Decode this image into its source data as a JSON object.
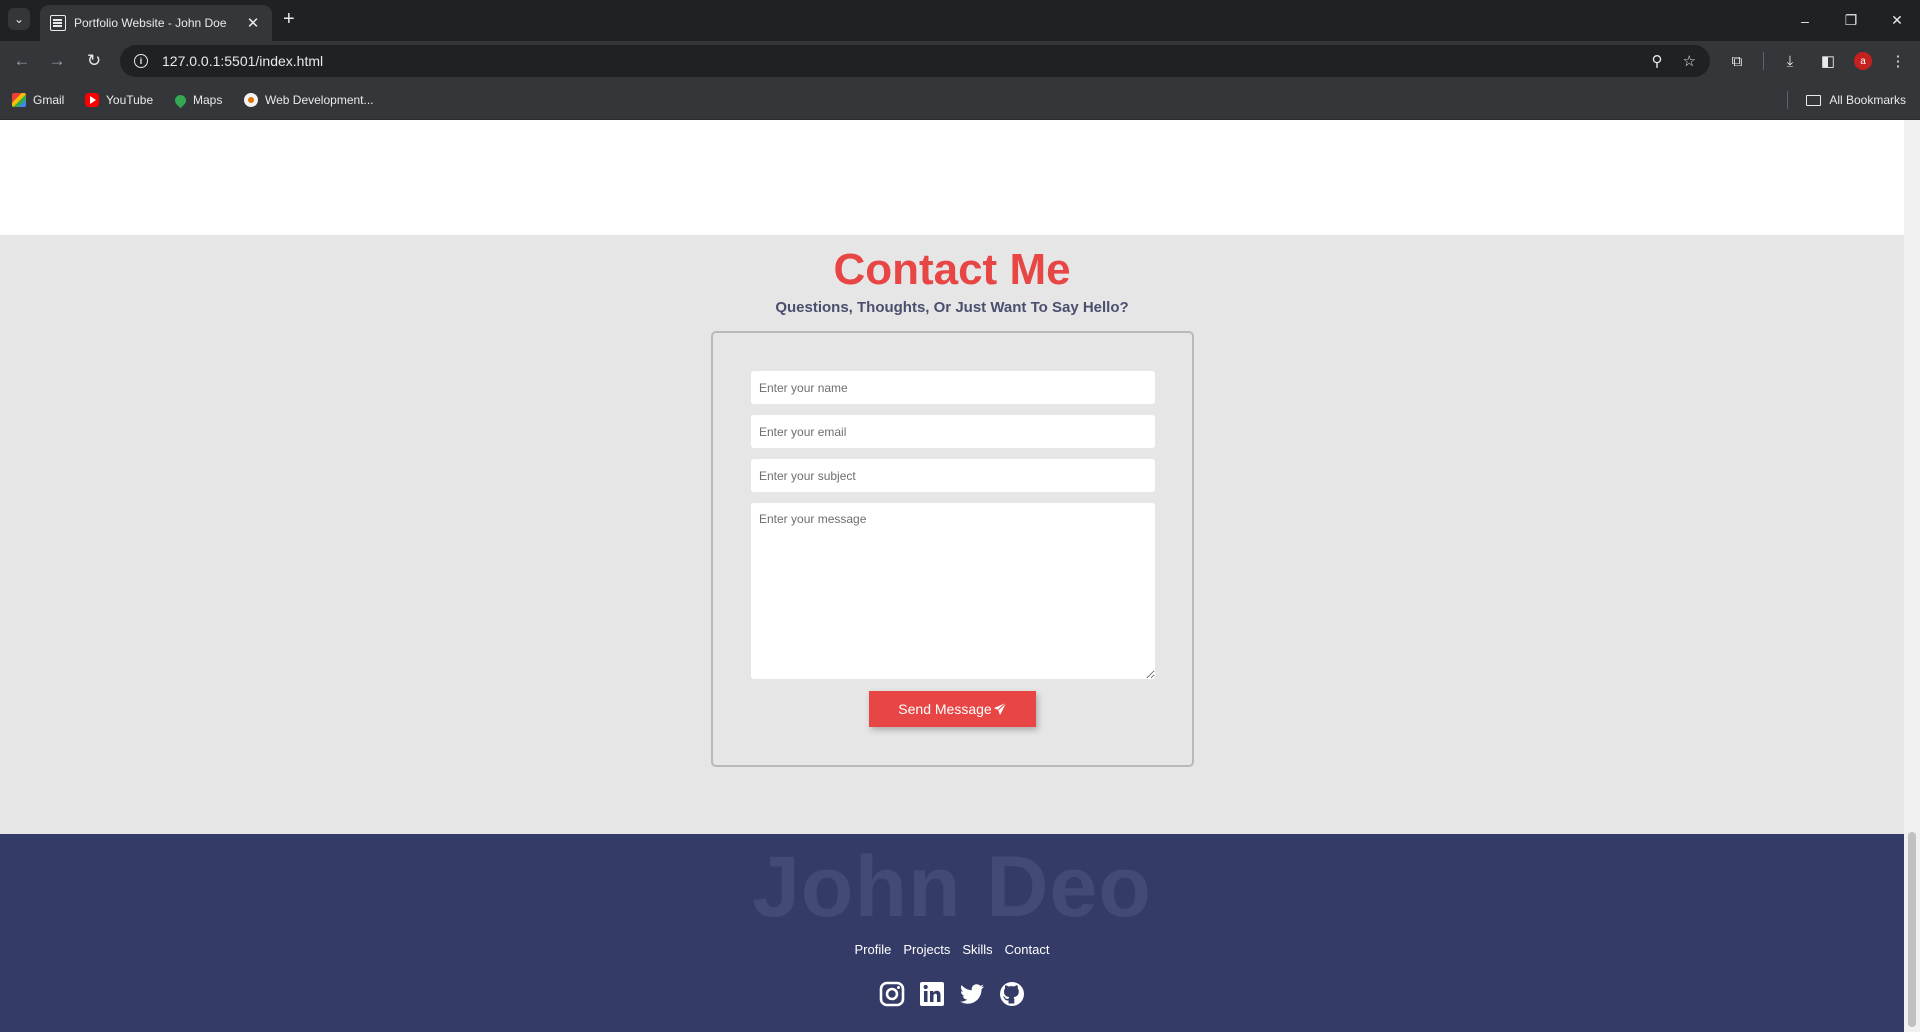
{
  "browser": {
    "tab_title": "Portfolio Website - John Doe",
    "url": "127.0.0.1:5501/index.html",
    "bookmarks": [
      "Gmail",
      "YouTube",
      "Maps",
      "Web Development..."
    ],
    "all_bookmarks": "All Bookmarks",
    "profile_initial": "a"
  },
  "contact": {
    "title": "Contact Me",
    "subtitle": "Questions, Thoughts, Or Just Want To Say Hello?",
    "name_placeholder": "Enter your name",
    "email_placeholder": "Enter your email",
    "subject_placeholder": "Enter your subject",
    "message_placeholder": "Enter your message",
    "send_label": "Send Message"
  },
  "footer": {
    "brand": "John Deo",
    "links": [
      "Profile",
      "Projects",
      "Skills",
      "Contact"
    ],
    "social": [
      "instagram-icon",
      "linkedin-icon",
      "twitter-icon",
      "github-icon"
    ]
  },
  "colors": {
    "accent": "#e84545",
    "footer_bg": "#343b66",
    "section_bg": "#e6e6e6"
  }
}
